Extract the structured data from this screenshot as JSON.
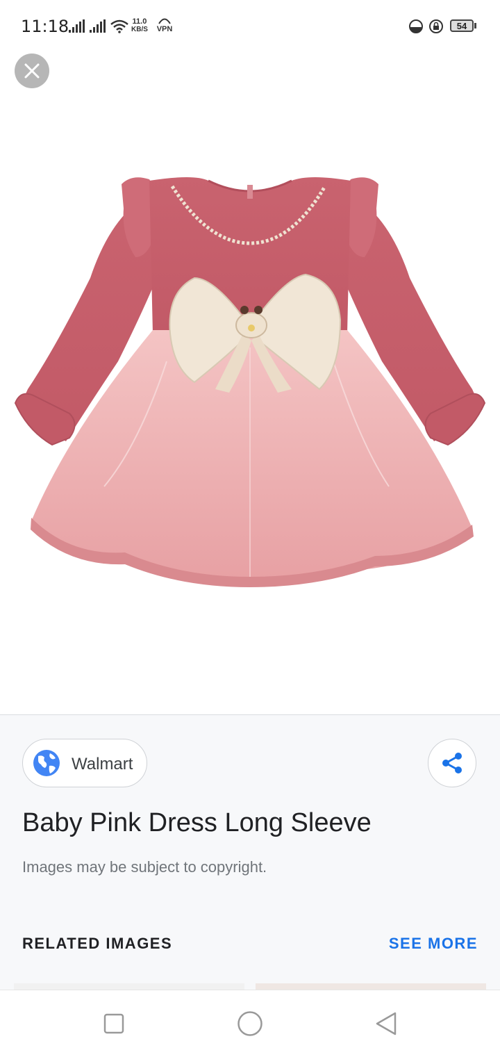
{
  "status_bar": {
    "time": "11:18",
    "net_speed_value": "11.0",
    "net_speed_unit": "KB/S",
    "vpn_label": "VPN",
    "battery_level": "54"
  },
  "viewer": {
    "close_icon": "close-icon",
    "image_description_icon": "pink-dress-image"
  },
  "info": {
    "source_label": "Walmart",
    "source_icon": "globe-icon",
    "share_icon": "share-icon",
    "title": "Baby Pink Dress Long Sleeve",
    "copyright_note": "Images may be subject to copyright.",
    "related_heading": "RELATED IMAGES",
    "see_more_label": "SEE MORE"
  },
  "nav": {
    "recents_icon": "square-icon",
    "home_icon": "circle-icon",
    "back_icon": "triangle-back-icon"
  },
  "colors": {
    "accent": "#1a73e8",
    "panel_bg": "#f7f8fa"
  }
}
